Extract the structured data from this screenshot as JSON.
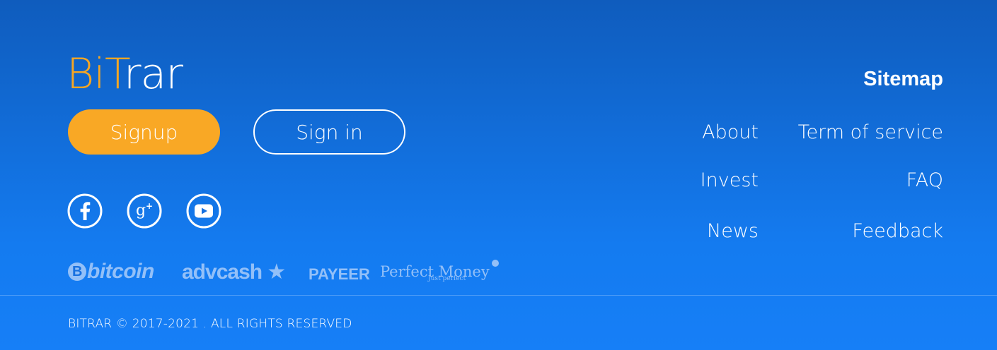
{
  "brand": {
    "logo_part1": "Bi",
    "logo_part2": "T",
    "logo_part3": "rar",
    "accent_color": "#f9a825"
  },
  "auth": {
    "signup_label": "Signup",
    "signin_label": "Sign in"
  },
  "social": [
    {
      "icon": "facebook-icon"
    },
    {
      "icon": "google-plus-icon"
    },
    {
      "icon": "youtube-icon"
    }
  ],
  "payments": {
    "bitcoin": "bitcoin",
    "bitcoin_symbol": "B",
    "advcash": "advcash",
    "payeer": "PAYEER",
    "perfect_money": "Perfect Money",
    "perfect_money_sub": "Just perfect"
  },
  "sitemap": {
    "title": "Sitemap",
    "links": {
      "about": "About",
      "terms": "Term of service",
      "invest": "Invest",
      "faq": "FAQ",
      "news": "News",
      "feedback": "Feedback"
    }
  },
  "footer": {
    "copyright": "BITRAR © 2017-2021 . ALL RIGHTS RESERVED"
  }
}
